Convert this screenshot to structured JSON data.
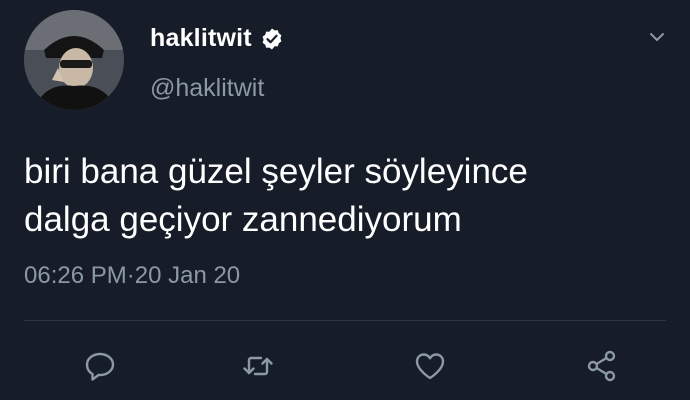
{
  "tweet": {
    "display_name": "haklitwit",
    "handle": "@haklitwit",
    "text": "biri bana güzel şeyler söyleyince\ndalga geçiyor zannediyorum",
    "time": "06:26 PM",
    "separator": " · ",
    "date": "20 Jan 20",
    "verified": true
  },
  "icons": {
    "verified": "verified-badge-icon",
    "caret": "chevron-down-icon",
    "reply": "reply-icon",
    "retweet": "retweet-icon",
    "like": "heart-icon",
    "share": "share-icon"
  },
  "colors": {
    "background": "#161d28",
    "text": "#ffffff",
    "secondary": "#8b98a5",
    "icon": "#8b98a5",
    "divider": "#2c3643"
  }
}
